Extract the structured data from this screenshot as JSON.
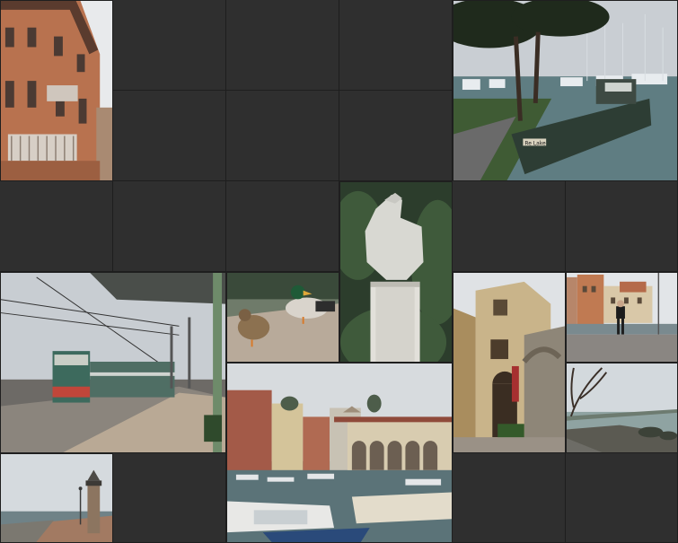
{
  "gallery": {
    "photos": [
      {
        "icon": "palazzo-facade-photo"
      },
      {
        "icon": "harbor-boat-photo"
      },
      {
        "icon": "eagle-statue-photo"
      },
      {
        "icon": "train-station-photo"
      },
      {
        "icon": "ducks-photo"
      },
      {
        "icon": "stone-building-photo"
      },
      {
        "icon": "man-waterfront-photo"
      },
      {
        "icon": "lake-shore-photo"
      },
      {
        "icon": "harbor-town-photo"
      },
      {
        "icon": "lighthouse-photo"
      }
    ],
    "boat_sign": "Re Lake"
  },
  "colors": {
    "background": "#2e2e2e",
    "empty_tile": "#2f2f2f",
    "tile_border": "#1e1e1e"
  }
}
